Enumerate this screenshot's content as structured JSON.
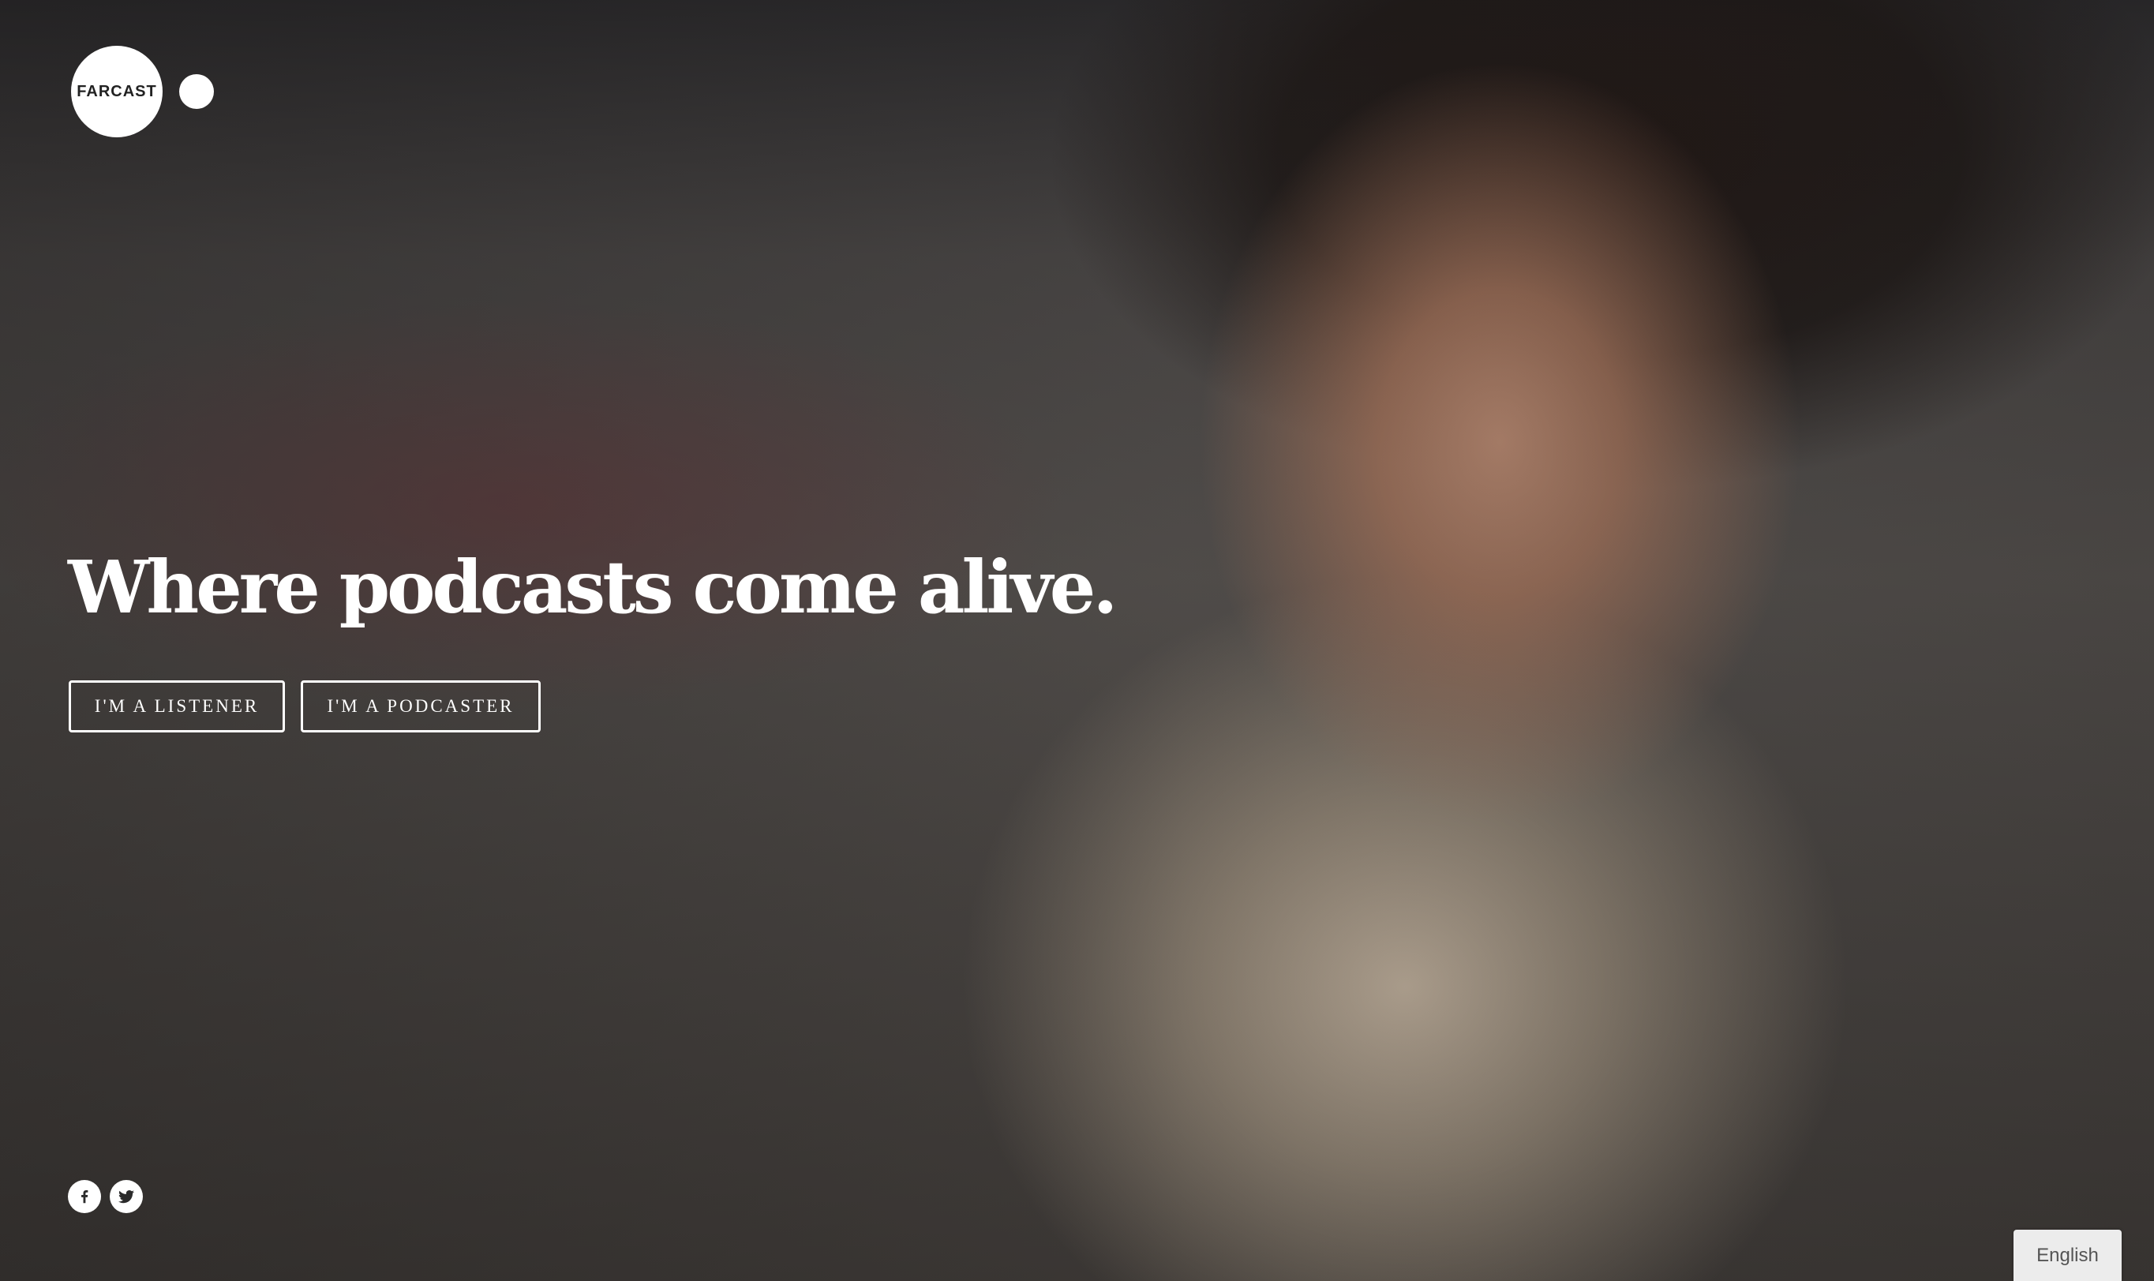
{
  "brand": {
    "logo_text": "FARCAST"
  },
  "hero": {
    "headline": "Where podcasts come alive.",
    "buttons": {
      "listener": "I'M A LISTENER",
      "podcaster": "I'M A PODCASTER"
    }
  },
  "social": {
    "icons": [
      "facebook-icon",
      "twitter-icon"
    ]
  },
  "language_selector": {
    "value": "English"
  },
  "colors": {
    "text": "#ffffff",
    "button_border": "#ffffff",
    "language_bg": "#ececec"
  }
}
